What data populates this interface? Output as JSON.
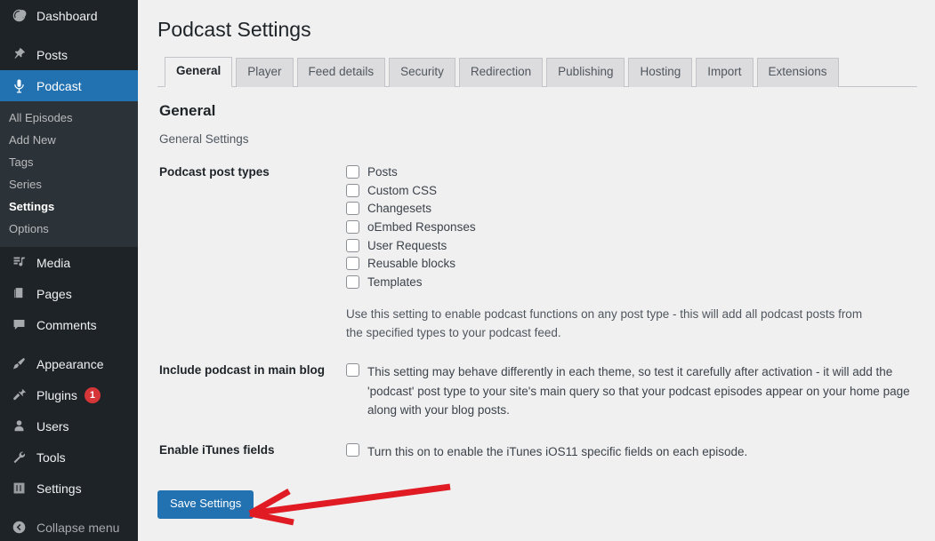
{
  "sidebar": {
    "items": [
      {
        "label": "Dashboard",
        "icon": "dashboard-icon",
        "name": "dashboard"
      },
      {
        "label": "Posts",
        "icon": "pin-icon",
        "name": "posts"
      },
      {
        "label": "Podcast",
        "icon": "microphone-icon",
        "name": "podcast",
        "active": true
      }
    ],
    "submenu": [
      {
        "label": "All Episodes",
        "current": false
      },
      {
        "label": "Add New",
        "current": false
      },
      {
        "label": "Tags",
        "current": false
      },
      {
        "label": "Series",
        "current": false
      },
      {
        "label": "Settings",
        "current": true
      },
      {
        "label": "Options",
        "current": false
      }
    ],
    "items2": [
      {
        "label": "Media",
        "icon": "media-icon",
        "name": "media"
      },
      {
        "label": "Pages",
        "icon": "pages-icon",
        "name": "pages"
      },
      {
        "label": "Comments",
        "icon": "comments-icon",
        "name": "comments"
      }
    ],
    "items3": [
      {
        "label": "Appearance",
        "icon": "brush-icon",
        "name": "appearance"
      },
      {
        "label": "Plugins",
        "icon": "plug-icon",
        "name": "plugins",
        "badge": "1"
      },
      {
        "label": "Users",
        "icon": "user-icon",
        "name": "users"
      },
      {
        "label": "Tools",
        "icon": "wrench-icon",
        "name": "tools"
      },
      {
        "label": "Settings",
        "icon": "settings-icon",
        "name": "settings"
      }
    ],
    "collapse_label": "Collapse menu",
    "badge_color": "#d63638",
    "active_color": "#2271b1",
    "background": "#1d2327",
    "submenu_background": "#2c3338"
  },
  "header": {
    "title": "Podcast Settings"
  },
  "tabs": [
    {
      "label": "General",
      "active": true
    },
    {
      "label": "Player",
      "active": false
    },
    {
      "label": "Feed details",
      "active": false
    },
    {
      "label": "Security",
      "active": false
    },
    {
      "label": "Redirection",
      "active": false
    },
    {
      "label": "Publishing",
      "active": false
    },
    {
      "label": "Hosting",
      "active": false
    },
    {
      "label": "Import",
      "active": false
    },
    {
      "label": "Extensions",
      "active": false
    }
  ],
  "section": {
    "title": "General",
    "description": "General Settings"
  },
  "form": {
    "post_types": {
      "label": "Podcast post types",
      "options": [
        {
          "label": "Posts",
          "checked": false
        },
        {
          "label": "Custom CSS",
          "checked": false
        },
        {
          "label": "Changesets",
          "checked": false
        },
        {
          "label": "oEmbed Responses",
          "checked": false
        },
        {
          "label": "User Requests",
          "checked": false
        },
        {
          "label": "Reusable blocks",
          "checked": false
        },
        {
          "label": "Templates",
          "checked": false
        }
      ],
      "help": "Use this setting to enable podcast functions on any post type - this will add all podcast posts from the specified types to your podcast feed."
    },
    "include_blog": {
      "label": "Include podcast in main blog",
      "checked": false,
      "description": "This setting may behave differently in each theme, so test it carefully after activation - it will add the 'podcast' post type to your site's main query so that your podcast episodes appear on your home page along with your blog posts."
    },
    "itunes_fields": {
      "label": "Enable iTunes fields",
      "checked": false,
      "description": "Turn this on to enable the iTunes iOS11 specific fields on each episode."
    }
  },
  "actions": {
    "save_label": "Save Settings",
    "save_color": "#2271b1"
  },
  "annotation": {
    "type": "arrow",
    "color": "#e01b24",
    "points_to": "Save Settings"
  }
}
